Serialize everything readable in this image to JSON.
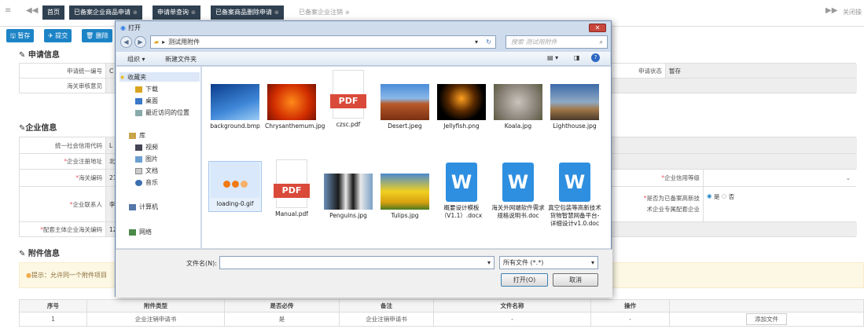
{
  "topbar": {
    "tabs": [
      "首页",
      "已备案企业商品申请",
      "申请单查询",
      "已备案商品删除申请",
      "已备案企业注销"
    ],
    "close_ops": "关闭操"
  },
  "actions": {
    "save": "暂存",
    "submit": "提交",
    "delete": "删除"
  },
  "sections": {
    "apply_info": "申请信息",
    "enterprise_info": "企业信息",
    "attachment_info": "附件信息"
  },
  "apply": {
    "seq_no_label": "申请统一编号",
    "seq_no_value": "C",
    "customs_opinion_label": "海关审核意见",
    "status_label": "申请状态",
    "status_value": "暂存"
  },
  "enterprise": {
    "credit_code_label": "统一社会信用代码",
    "credit_code_value": "L",
    "reg_addr_label": "企业注册地址",
    "reg_addr_value": "北",
    "customs_code_label": "海关编码",
    "customs_code_value": "21",
    "credit_level_label": "企业信用等级",
    "contact_label": "企业联系人",
    "contact_value": "李",
    "tech_label_1": "是否为已备案高新技",
    "tech_label_2": "术企业专属配套企业",
    "radio_yes": "是",
    "radio_no": "否",
    "main_customs_label": "配套主体企业海关编码",
    "main_customs_value": "12"
  },
  "notice": "提示：允许同一个附件项目",
  "attach_table": {
    "headers": [
      "序号",
      "附件类型",
      "是否必传",
      "备注",
      "文件名称",
      "操作"
    ],
    "rows": [
      {
        "no": "1",
        "type": "企业注销申请书",
        "required": "是",
        "remark": "企业注销申请书",
        "filename": "-",
        "op": "-",
        "btn": "添加文件"
      }
    ]
  },
  "dialog": {
    "title": "打开",
    "path": "测试用附件",
    "search_placeholder": "搜索 测试用附件",
    "organize": "组织 ▾",
    "new_folder": "新建文件夹",
    "nav": {
      "favorites": "收藏夹",
      "downloads": "下载",
      "desktop": "桌面",
      "recent": "最近访问的位置",
      "library": "库",
      "videos": "视频",
      "pictures": "图片",
      "documents": "文档",
      "music": "音乐",
      "computer": "计算机",
      "network": "网络"
    },
    "files": [
      {
        "name": "background.bmp",
        "kind": "blue"
      },
      {
        "name": "Chrysanthemum.jpg",
        "kind": "flower"
      },
      {
        "name": "czsc.pdf",
        "kind": "pdf"
      },
      {
        "name": "Desert.jpeg",
        "kind": "desert"
      },
      {
        "name": "Jellyfish.png",
        "kind": "jelly"
      },
      {
        "name": "Koala.jpg",
        "kind": "koala"
      },
      {
        "name": "Lighthouse.jpg",
        "kind": "lighthouse"
      },
      {
        "name": "loading-0.gif",
        "kind": "gif"
      },
      {
        "name": "Manual.pdf",
        "kind": "pdf"
      },
      {
        "name": "Penguins.jpg",
        "kind": "penguin"
      },
      {
        "name": "Tulips.jpg",
        "kind": "tulip"
      },
      {
        "name": "概要设计模板（V1.1）.docx",
        "kind": "doc"
      },
      {
        "name": "海关外网端软件需求规格说明书.doc",
        "kind": "doc"
      },
      {
        "name": "真空包装等高新技术货物智慧网备平台-详细设计v1.0.doc",
        "kind": "doc"
      }
    ],
    "filename_label": "文件名(N):",
    "filetype": "所有文件 (*.*)",
    "open_btn": "打开(O)",
    "cancel_btn": "取消"
  }
}
